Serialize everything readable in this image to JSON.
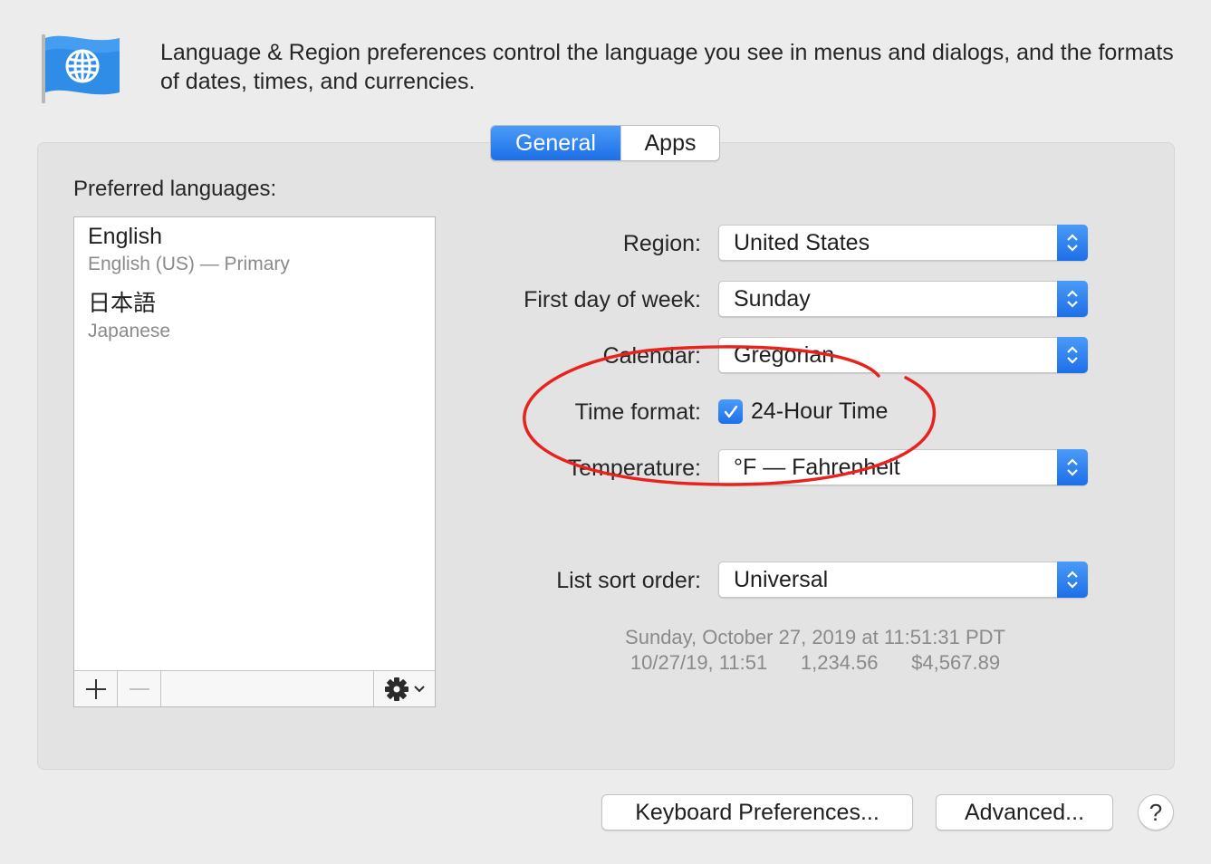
{
  "header": {
    "icon": "globe-flag-icon",
    "description": "Language & Region preferences control the language you see in menus and dialogs, and the formats of dates, times, and currencies."
  },
  "tabs": [
    {
      "label": "General",
      "selected": true
    },
    {
      "label": "Apps",
      "selected": false
    }
  ],
  "languages": {
    "heading": "Preferred languages:",
    "items": [
      {
        "name": "English",
        "detail": "English (US) — Primary"
      },
      {
        "name": "日本語",
        "detail": "Japanese"
      }
    ],
    "toolbar": {
      "add": "+",
      "remove": "—",
      "action_icon": "gear-icon"
    }
  },
  "form": {
    "region": {
      "label": "Region:",
      "value": "United States"
    },
    "first_day": {
      "label": "First day of week:",
      "value": "Sunday"
    },
    "calendar": {
      "label": "Calendar:",
      "value": "Gregorian"
    },
    "time_format": {
      "label": "Time format:",
      "checkbox_label": "24-Hour Time",
      "checked": true
    },
    "temperature": {
      "label": "Temperature:",
      "value": "°F — Fahrenheit"
    },
    "sort_order": {
      "label": "List sort order:",
      "value": "Universal"
    }
  },
  "sample": {
    "line1": "Sunday, October 27, 2019 at 11:51:31 PDT",
    "line2": "10/27/19, 11:51      1,234.56      $4,567.89"
  },
  "buttons": {
    "keyboard": "Keyboard Preferences...",
    "advanced": "Advanced...",
    "help": "?"
  },
  "colors": {
    "accent": "#1d6fe8",
    "annotation": "#e8231d",
    "window_bg": "#ececec"
  }
}
